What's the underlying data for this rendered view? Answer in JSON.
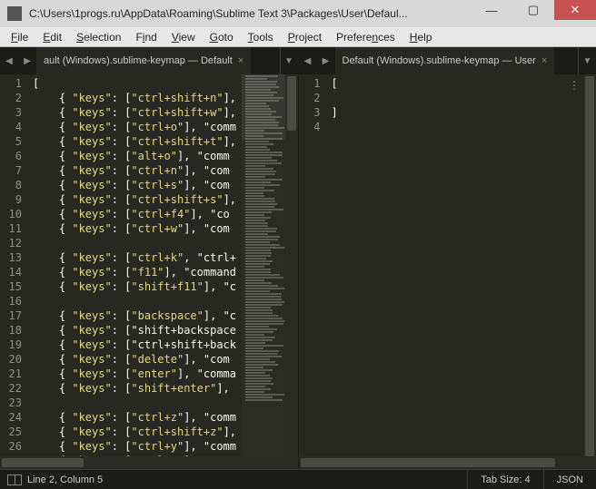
{
  "window": {
    "title": "C:\\Users\\1progs.ru\\AppData\\Roaming\\Sublime Text 3\\Packages\\User\\Defaul..."
  },
  "menu": {
    "items": [
      "File",
      "Edit",
      "Selection",
      "Find",
      "View",
      "Goto",
      "Tools",
      "Project",
      "Preferences",
      "Help"
    ]
  },
  "panes": {
    "left": {
      "tab_label": "ault (Windows).sublime-keymap — Default",
      "lines": [
        "[",
        "    { \"keys\": [\"ctrl+shift+n\"],",
        "    { \"keys\": [\"ctrl+shift+w\"],",
        "    { \"keys\": [\"ctrl+o\"], \"comm",
        "    { \"keys\": [\"ctrl+shift+t\"],",
        "    { \"keys\": [\"alt+o\"], \"comm",
        "    { \"keys\": [\"ctrl+n\"], \"com",
        "    { \"keys\": [\"ctrl+s\"], \"com",
        "    { \"keys\": [\"ctrl+shift+s\"],",
        "    { \"keys\": [\"ctrl+f4\"], \"co",
        "    { \"keys\": [\"ctrl+w\"], \"com",
        "",
        "    { \"keys\": [\"ctrl+k\", \"ctrl+",
        "    { \"keys\": [\"f11\"], \"command",
        "    { \"keys\": [\"shift+f11\"], \"c",
        "",
        "    { \"keys\": [\"backspace\"], \"c",
        "    { \"keys\": [\"shift+backspace",
        "    { \"keys\": [\"ctrl+shift+back",
        "    { \"keys\": [\"delete\"], \"com",
        "    { \"keys\": [\"enter\"], \"comma",
        "    { \"keys\": [\"shift+enter\"],",
        "",
        "    { \"keys\": [\"ctrl+z\"], \"comm",
        "    { \"keys\": [\"ctrl+shift+z\"],",
        "    { \"keys\": [\"ctrl+y\"], \"comm",
        "    { \"keys\": [\"ctrl+u\"], \"comm"
      ]
    },
    "right": {
      "tab_label": "Default (Windows).sublime-keymap — User",
      "lines": [
        "[",
        "",
        "]",
        ""
      ]
    }
  },
  "status": {
    "position": "Line 2, Column 5",
    "tab_size": "Tab Size: 4",
    "syntax": "JSON"
  }
}
